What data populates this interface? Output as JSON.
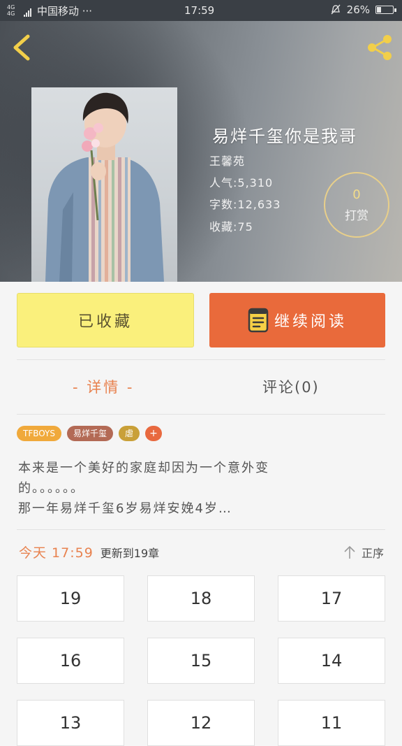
{
  "status_bar": {
    "network": "4G 4G",
    "carrier": "中国移动 ···",
    "time": "17:59",
    "battery": "26%",
    "battery_level": 0.26
  },
  "book": {
    "title": "易烊千玺你是我哥",
    "author": "王馨苑",
    "popularity": "人气:5,310",
    "word_count": "字数:12,633",
    "favorites": "收藏:75"
  },
  "reward": {
    "count": "0",
    "label": "打赏"
  },
  "actions": {
    "favorited_label": "已收藏",
    "continue_label": "继续阅读"
  },
  "tabs": {
    "detail": "- 详情 -",
    "comments": "评论(0)"
  },
  "tags": [
    {
      "label": "TFBOYS",
      "color": "#f0a93b"
    },
    {
      "label": "易烊千玺",
      "color": "#b36a55"
    },
    {
      "label": "虐",
      "color": "#c9a038"
    },
    {
      "label": "+",
      "color": "#e8693f"
    }
  ],
  "summary": [
    "本来是一个美好的家庭却因为一个意外变",
    "的。。。。。。",
    "那一年易烊千玺6岁易烊安娩4岁…"
  ],
  "update": {
    "today": "今天 17:59",
    "text": "更新到19章",
    "sort_label": "正序"
  },
  "chapters": [
    "19",
    "18",
    "17",
    "16",
    "15",
    "14",
    "13",
    "12",
    "11"
  ],
  "colors": {
    "accent_orange": "#e96a3b",
    "fav_yellow": "#faf07c",
    "tab_active": "#e8824f"
  }
}
